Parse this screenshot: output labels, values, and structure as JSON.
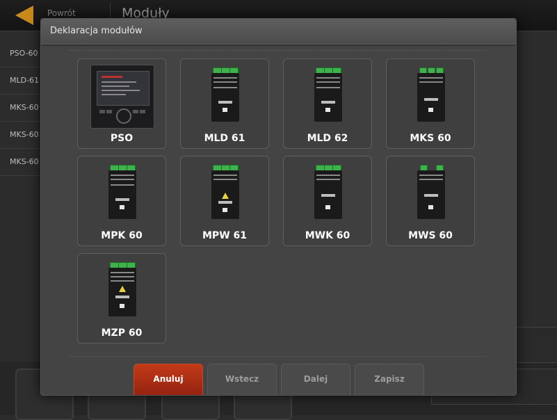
{
  "app": {
    "back_label": "Powrót",
    "title": "Moduły",
    "side_items": [
      "PSO-60 (",
      "MLD-61",
      "MKS-60",
      "MKS-60",
      "MKS-60"
    ]
  },
  "modal": {
    "title": "Deklaracja modułów",
    "modules": [
      {
        "label": "PSO",
        "icon": "pso-panel-icon"
      },
      {
        "label": "MLD 61",
        "icon": "module-icon"
      },
      {
        "label": "MLD 62",
        "icon": "module-icon"
      },
      {
        "label": "MKS 60",
        "icon": "module-icon"
      },
      {
        "label": "MPK 60",
        "icon": "module-icon"
      },
      {
        "label": "MPW 61",
        "icon": "module-warning-icon"
      },
      {
        "label": "MWK 60",
        "icon": "module-icon"
      },
      {
        "label": "MWS 60",
        "icon": "module-icon"
      },
      {
        "label": "MZP 60",
        "icon": "module-warning-icon"
      }
    ],
    "buttons": {
      "cancel": "Anuluj",
      "back": "Wstecz",
      "next": "Dalej",
      "save": "Zapisz"
    }
  },
  "colors": {
    "primary_button": "#b3301a",
    "terminal_green": "#3fb34b",
    "back_arrow": "#c98a1a"
  }
}
